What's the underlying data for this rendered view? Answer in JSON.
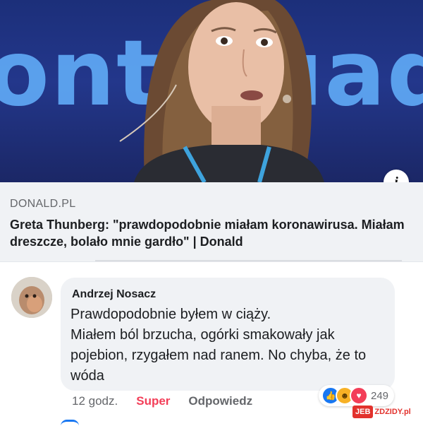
{
  "link_card": {
    "image_background_text": "ontinuad",
    "source": "DONALD.PL",
    "headline": "Greta Thunberg: \"prawdopodobnie miałam koronawirusa. Miałam dreszcze, bolało mnie gardło\" | Donald",
    "info_icon": "info-icon",
    "info_glyph": "i"
  },
  "comment": {
    "author": "Andrzej Nosacz",
    "text": "Prawdopodobnie byłem w ciąży.\nMiałem ból brzucha, ogórki smakowały jak pojebion, rzygałem nad ranem. No chyba, że to wóda",
    "time": "12 godz.",
    "reaction_label": "Super",
    "reply_label": "Odpowiedz",
    "reaction_count": "249",
    "reaction_icons": [
      "like-icon",
      "haha-icon",
      "love-icon"
    ]
  },
  "watermark": {
    "left": "JEB",
    "right": "ZDZIDY.pl"
  },
  "colors": {
    "link_blue": "#1877f2",
    "super_red": "#f33e58",
    "secondary_text": "#65676b",
    "bubble_bg": "#f0f2f5"
  }
}
